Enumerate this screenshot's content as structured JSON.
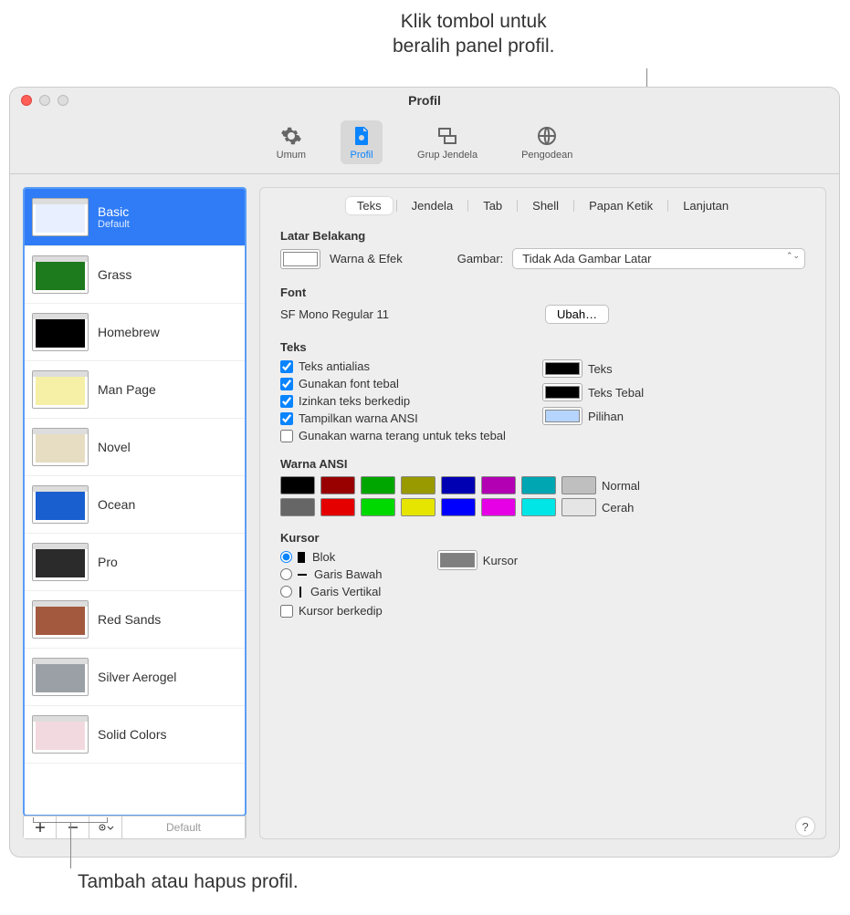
{
  "callouts": {
    "top": "Klik tombol untuk\nberalih panel profil.",
    "bottom": "Tambah atau hapus profil."
  },
  "window": {
    "title": "Profil"
  },
  "toolbar": {
    "general": "Umum",
    "profiles": "Profil",
    "window_groups": "Grup Jendela",
    "encodings": "Pengodean"
  },
  "sidebar": {
    "profiles": [
      {
        "name": "Basic",
        "subtitle": "Default",
        "bg": "#ffffff",
        "text": "#2f7cf6",
        "body": "#e8f0ff",
        "selected": true
      },
      {
        "name": "Grass",
        "bg": "#1d7a1d",
        "text": "#ffffff",
        "body": "#1d7a1d"
      },
      {
        "name": "Homebrew",
        "bg": "#000000",
        "text": "#33ff66",
        "body": "#000000"
      },
      {
        "name": "Man Page",
        "bg": "#f5f0a6",
        "text": "#333333",
        "body": "#f5f0a6"
      },
      {
        "name": "Novel",
        "bg": "#e6ddc2",
        "text": "#7a4a2a",
        "body": "#e6ddc2"
      },
      {
        "name": "Ocean",
        "bg": "#1a5fd0",
        "text": "#ffffff",
        "body": "#1a5fd0"
      },
      {
        "name": "Pro",
        "bg": "#2b2b2b",
        "text": "#dddddd",
        "body": "#2b2b2b"
      },
      {
        "name": "Red Sands",
        "bg": "#a2593e",
        "text": "#ffe0a0",
        "body": "#a2593e"
      },
      {
        "name": "Silver Aerogel",
        "bg": "#9aa0a6",
        "text": "#222222",
        "body": "#9aa0a6"
      },
      {
        "name": "Solid Colors",
        "bg": "#f2d9e0",
        "text": "#888888",
        "body": "#f2d9e0"
      }
    ],
    "default_button": "Default"
  },
  "tabs": {
    "text": "Teks",
    "window": "Jendela",
    "tab": "Tab",
    "shell": "Shell",
    "keyboard": "Papan Ketik",
    "advanced": "Lanjutan"
  },
  "background": {
    "title": "Latar Belakang",
    "color_effects": "Warna & Efek",
    "image_label": "Gambar:",
    "image_value": "Tidak Ada Gambar Latar",
    "well_color": "#ffffff"
  },
  "font": {
    "title": "Font",
    "value": "SF Mono Regular 11",
    "change": "Ubah…"
  },
  "text": {
    "title": "Teks",
    "antialias": "Teks antialias",
    "bold": "Gunakan font tebal",
    "blink": "Izinkan teks berkedip",
    "ansi": "Tampilkan warna ANSI",
    "bright": "Gunakan warna terang untuk teks tebal",
    "text_color_label": "Teks",
    "bold_color_label": "Teks Tebal",
    "selection_label": "Pilihan",
    "text_color": "#000000",
    "bold_color": "#000000",
    "selection_color": "#b5d5ff"
  },
  "ansi": {
    "title": "Warna ANSI",
    "normal_label": "Normal",
    "bright_label": "Cerah",
    "normal": [
      "#000000",
      "#990000",
      "#00a600",
      "#999900",
      "#0000b2",
      "#b200b2",
      "#00a6b2",
      "#bfbfbf"
    ],
    "bright": [
      "#666666",
      "#e50000",
      "#00d900",
      "#e5e500",
      "#0000ff",
      "#e500e5",
      "#00e5e5",
      "#e5e5e5"
    ]
  },
  "cursor": {
    "title": "Kursor",
    "block": "Blok",
    "underline": "Garis Bawah",
    "vertical": "Garis Vertikal",
    "blink": "Kursor berkedip",
    "color_label": "Kursor",
    "color": "#7f7f7f"
  },
  "help": "?"
}
